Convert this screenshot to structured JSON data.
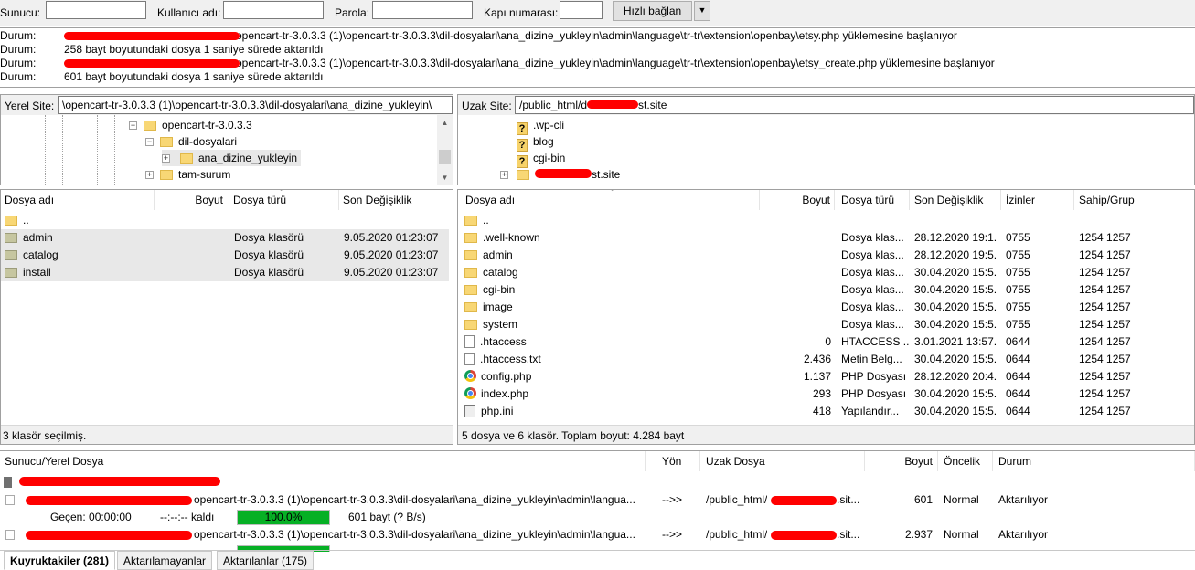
{
  "quickconnect": {
    "host_label": "Sunucu:",
    "host_value": "",
    "user_label": "Kullanıcı adı:",
    "user_value": "",
    "pass_label": "Parola:",
    "pass_value": "",
    "port_label": "Kapı numarası:",
    "port_value": "",
    "connect_label": "Hızlı bağlan",
    "dropdown_icon": "chevron-down-icon"
  },
  "log": [
    {
      "label": "Durum:",
      "text": "opencart-tr-3.0.3.3 (1)\\opencart-tr-3.0.3.3\\dil-dosyalari\\ana_dizine_yukleyin\\admin\\language\\tr-tr\\extension\\openbay\\etsy.php yüklemesine başlanıyor"
    },
    {
      "label": "Durum:",
      "text": "258 bayt boyutundaki dosya 1 saniye sürede aktarıldı"
    },
    {
      "label": "Durum:",
      "text": "opencart-tr-3.0.3.3 (1)\\opencart-tr-3.0.3.3\\dil-dosyalari\\ana_dizine_yukleyin\\admin\\language\\tr-tr\\extension\\openbay\\etsy_create.php yüklemesine başlanıyor"
    },
    {
      "label": "Durum:",
      "text": "601 bayt boyutundaki dosya 1 saniye sürede aktarıldı"
    }
  ],
  "local": {
    "site_label": "Yerel Site:",
    "site_path": "\\opencart-tr-3.0.3.3 (1)\\opencart-tr-3.0.3.3\\dil-dosyalari\\ana_dizine_yukleyin\\",
    "tree": [
      "opencart-tr-3.0.3.3",
      "dil-dosyalari",
      "ana_dizine_yukleyin",
      "tam-surum"
    ],
    "headers": {
      "name": "Dosya adı",
      "size": "Boyut",
      "type": "Dosya türü",
      "modified": "Son Değişiklik"
    },
    "files": [
      {
        "name": "..",
        "type": "",
        "modified": ""
      },
      {
        "name": "admin",
        "type": "Dosya klasörü",
        "modified": "9.05.2020 01:23:07"
      },
      {
        "name": "catalog",
        "type": "Dosya klasörü",
        "modified": "9.05.2020 01:23:07"
      },
      {
        "name": "install",
        "type": "Dosya klasörü",
        "modified": "9.05.2020 01:23:07"
      }
    ],
    "status": "3 klasör seçilmiş."
  },
  "remote": {
    "site_label": "Uzak Site:",
    "site_path_prefix": "/public_html/d",
    "site_path_suffix": "st.site",
    "tree": [
      ".wp-cli",
      "blog",
      "cgi-bin",
      "st.site"
    ],
    "headers": {
      "name": "Dosya adı",
      "size": "Boyut",
      "type": "Dosya türü",
      "modified": "Son Değişiklik",
      "perms": "İzinler",
      "owner": "Sahip/Grup"
    },
    "files": [
      {
        "name": "..",
        "icon": "folder",
        "size": "",
        "type": "",
        "modified": "",
        "perms": "",
        "owner": ""
      },
      {
        "name": ".well-known",
        "icon": "folder",
        "size": "",
        "type": "Dosya klas...",
        "modified": "28.12.2020 19:1...",
        "perms": "0755",
        "owner": "1254 1257"
      },
      {
        "name": "admin",
        "icon": "folder",
        "size": "",
        "type": "Dosya klas...",
        "modified": "28.12.2020 19:5...",
        "perms": "0755",
        "owner": "1254 1257"
      },
      {
        "name": "catalog",
        "icon": "folder",
        "size": "",
        "type": "Dosya klas...",
        "modified": "30.04.2020 15:5...",
        "perms": "0755",
        "owner": "1254 1257"
      },
      {
        "name": "cgi-bin",
        "icon": "folder",
        "size": "",
        "type": "Dosya klas...",
        "modified": "30.04.2020 15:5...",
        "perms": "0755",
        "owner": "1254 1257"
      },
      {
        "name": "image",
        "icon": "folder",
        "size": "",
        "type": "Dosya klas...",
        "modified": "30.04.2020 15:5...",
        "perms": "0755",
        "owner": "1254 1257"
      },
      {
        "name": "system",
        "icon": "folder",
        "size": "",
        "type": "Dosya klas...",
        "modified": "30.04.2020 15:5...",
        "perms": "0755",
        "owner": "1254 1257"
      },
      {
        "name": ".htaccess",
        "icon": "file",
        "size": "0",
        "type": "HTACCESS ...",
        "modified": "3.01.2021 13:57...",
        "perms": "0644",
        "owner": "1254 1257"
      },
      {
        "name": ".htaccess.txt",
        "icon": "file",
        "size": "2.436",
        "type": "Metin Belg...",
        "modified": "30.04.2020 15:5...",
        "perms": "0644",
        "owner": "1254 1257"
      },
      {
        "name": "config.php",
        "icon": "chrome",
        "size": "1.137",
        "type": "PHP Dosyası",
        "modified": "28.12.2020 20:4...",
        "perms": "0644",
        "owner": "1254 1257"
      },
      {
        "name": "index.php",
        "icon": "chrome",
        "size": "293",
        "type": "PHP Dosyası",
        "modified": "30.04.2020 15:5...",
        "perms": "0644",
        "owner": "1254 1257"
      },
      {
        "name": "php.ini",
        "icon": "config",
        "size": "418",
        "type": "Yapılandır...",
        "modified": "30.04.2020 15:5...",
        "perms": "0644",
        "owner": "1254 1257"
      }
    ],
    "status": "5 dosya ve 6 klasör. Toplam boyut: 4.284 bayt"
  },
  "queue": {
    "headers": {
      "local": "Sunucu/Yerel Dosya",
      "dir": "Yön",
      "remote": "Uzak Dosya",
      "size": "Boyut",
      "priority": "Öncelik",
      "status": "Durum"
    },
    "items": [
      {
        "local": "opencart-tr-3.0.3.3 (1)\\opencart-tr-3.0.3.3\\dil-dosyalari\\ana_dizine_yukleyin\\admin\\langua...",
        "dir": "-->>",
        "remote_prefix": "/public_html/",
        "remote_suffix": ".sit...",
        "size": "601",
        "priority": "Normal",
        "status": "Aktarılıyor",
        "elapsed": "Geçen: 00:00:00",
        "left": "--:--:-- kaldı",
        "progress": 1.0,
        "progress_label": "100.0%",
        "bytes": "601 bayt (? B/s)"
      },
      {
        "local": "opencart-tr-3.0.3.3 (1)\\opencart-tr-3.0.3.3\\dil-dosyalari\\ana_dizine_yukleyin\\admin\\langua...",
        "dir": "-->>",
        "remote_prefix": "/public_html/",
        "remote_suffix": ".sit...",
        "size": "2.937",
        "priority": "Normal",
        "status": "Aktarılıyor",
        "progress": 1.0
      }
    ]
  },
  "tabs": [
    {
      "label": "Kuyruktakiler (281)",
      "active": true
    },
    {
      "label": "Aktarılamayanlar",
      "active": false
    },
    {
      "label": "Aktarılanlar (175)",
      "active": false
    }
  ],
  "colors": {
    "progress": "#06b025",
    "redaction": "#ff0000",
    "folder": "#f8d775"
  }
}
